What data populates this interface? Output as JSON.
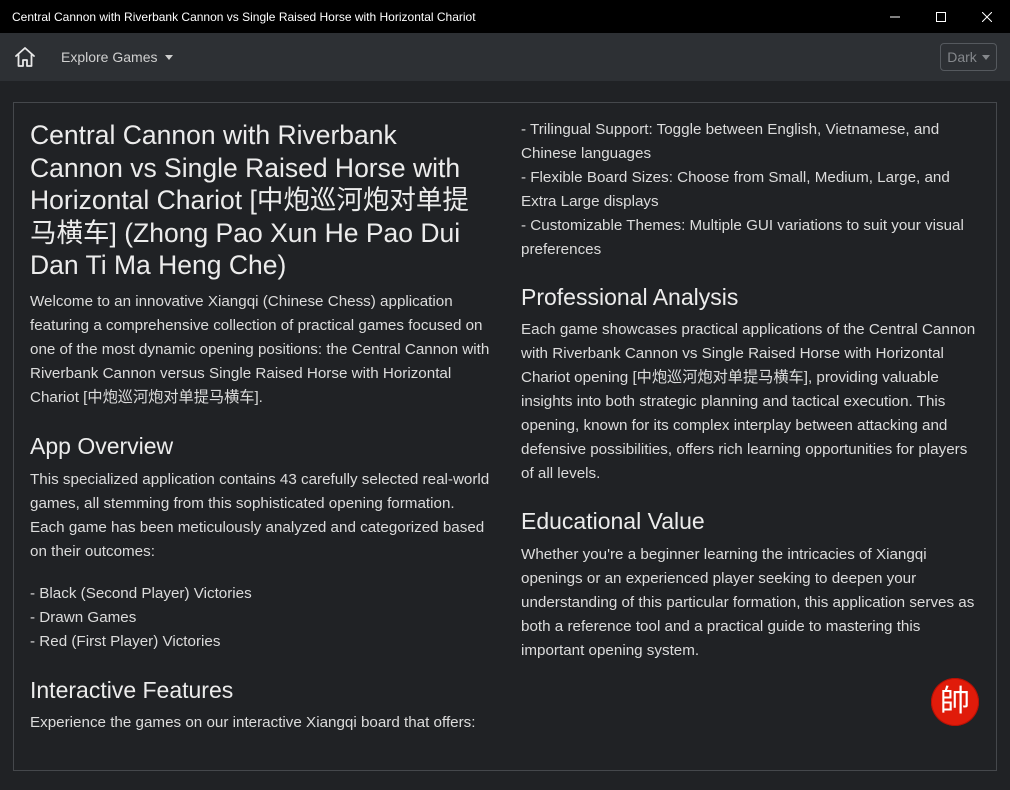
{
  "window": {
    "title": "Central Cannon with Riverbank Cannon vs Single Raised Horse with Horizontal Chariot"
  },
  "nav": {
    "explore_label": "Explore Games",
    "theme_label": "Dark"
  },
  "content": {
    "title": "Central Cannon with Riverbank Cannon vs Single Raised Horse with Horizontal Chariot [中炮巡河炮对单提马横车] (Zhong Pao Xun He Pao Dui Dan Ti Ma Heng Che)",
    "intro": "Welcome to an innovative Xiangqi (Chinese Chess) application featuring a comprehensive collection of practical games focused on one of the most dynamic opening positions: the Central Cannon with Riverbank Cannon versus Single Raised Horse with Horizontal Chariot [中炮巡河炮对单提马横车].",
    "overview_heading": "App Overview",
    "overview_text": "This specialized application contains 43 carefully selected real-world games, all stemming from this sophisticated opening formation. Each game has been meticulously analyzed and categorized based on their outcomes:",
    "outcomes": [
      "- Black (Second Player) Victories",
      "- Drawn Games",
      "- Red (First Player) Victories"
    ],
    "features_heading": "Interactive Features",
    "features_text": "Experience the games on our interactive Xiangqi board that offers:",
    "features": [
      "- Trilingual Support: Toggle between English, Vietnamese, and Chinese languages",
      "- Flexible Board Sizes: Choose from Small, Medium, Large, and Extra Large displays",
      "- Customizable Themes: Multiple GUI variations to suit your visual preferences"
    ],
    "analysis_heading": "Professional Analysis",
    "analysis_text": "Each game showcases practical applications of the Central Cannon with Riverbank Cannon vs Single Raised Horse with Horizontal Chariot opening [中炮巡河炮对单提马横车], providing valuable insights into both strategic planning and tactical execution. This opening, known for its complex interplay between attacking and defensive possibilities, offers rich learning opportunities for players of all levels.",
    "education_heading": "Educational Value",
    "education_text": "Whether you're a beginner learning the intricacies of Xiangqi openings or an experienced player seeking to deepen your understanding of this particular formation, this application serves as both a reference tool and a practical guide to mastering this important opening system."
  },
  "badge": {
    "glyph": "帥",
    "color": "#e01b0a"
  },
  "icons": {
    "home": "home-icon",
    "minimize": "minimize-icon",
    "maximize": "maximize-icon",
    "close": "close-icon"
  }
}
